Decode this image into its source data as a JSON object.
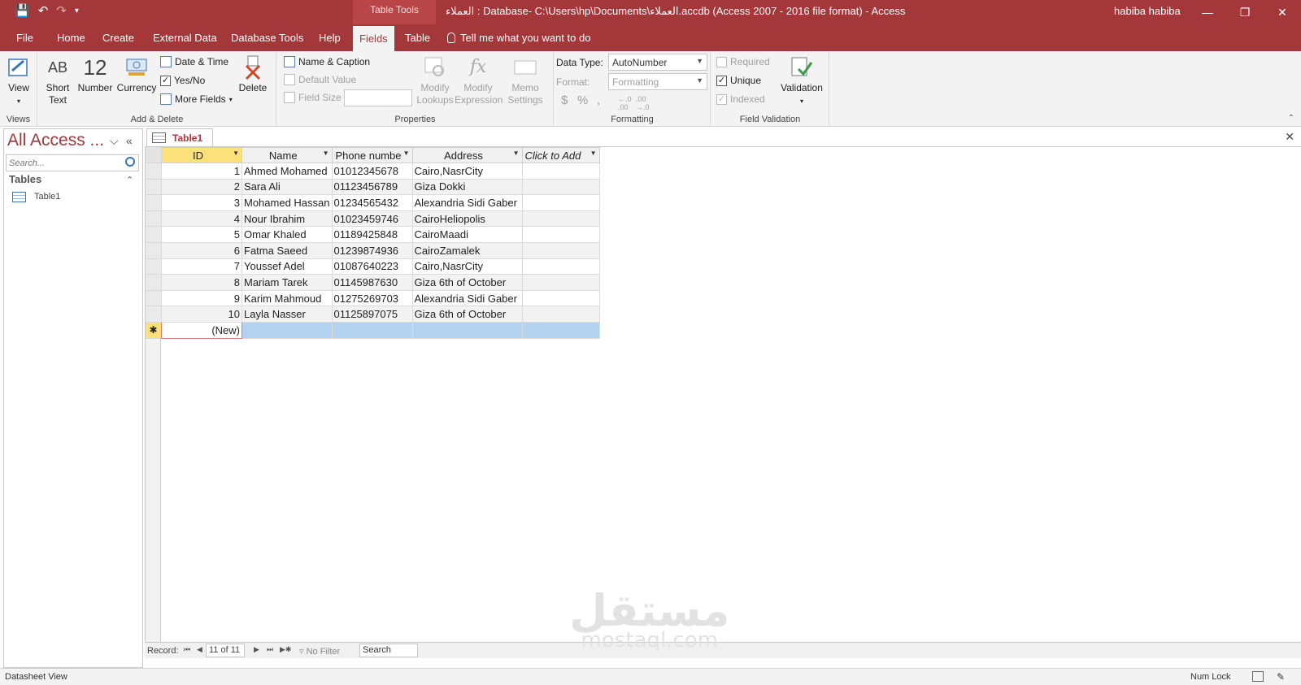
{
  "titlebar": {
    "context_tab": "Table Tools",
    "title": "العملاء : Database- C:\\Users\\hp\\Documents\\العملاء.accdb (Access 2007 - 2016 file format)  -  Access",
    "user": "habiba habiba"
  },
  "tabs": [
    "File",
    "Home",
    "Create",
    "External Data",
    "Database Tools",
    "Help",
    "Fields",
    "Table"
  ],
  "active_tab": "Fields",
  "tellme": "Tell me what you want to do",
  "ribbon": {
    "views": {
      "view_label": "View",
      "group_label": "Views"
    },
    "add_delete": {
      "short_text_glyph": "AB",
      "short_text": "Short Text",
      "number_glyph": "12",
      "number": "Number",
      "currency": "Currency",
      "date_time": "Date & Time",
      "yes_no": "Yes/No",
      "more_fields": "More Fields",
      "delete": "Delete",
      "group_label": "Add & Delete"
    },
    "properties": {
      "name_caption": "Name & Caption",
      "default_value": "Default Value",
      "field_size": "Field Size",
      "modify_lookups": "Modify Lookups",
      "modify_expression": "Modify Expression",
      "memo_settings": "Memo Settings",
      "group_label": "Properties"
    },
    "formatting": {
      "data_type_label": "Data Type:",
      "data_type_value": "AutoNumber",
      "format_label": "Format:",
      "format_value": "Formatting",
      "group_label": "Formatting"
    },
    "field_validation": {
      "required": "Required",
      "unique": "Unique",
      "indexed": "Indexed",
      "validation": "Validation",
      "group_label": "Field Validation"
    }
  },
  "nav": {
    "title": "All Access ...",
    "search_placeholder": "Search...",
    "group": "Tables",
    "items": [
      "Table1"
    ]
  },
  "document": {
    "tab": "Table1",
    "columns": [
      "ID",
      "Name",
      "Phone numbe",
      "Address",
      "Click to Add"
    ],
    "rows": [
      [
        "1",
        "Ahmed Mohamed",
        "01012345678",
        "Cairo,NasrCity"
      ],
      [
        "2",
        "Sara Ali",
        "01123456789",
        "Giza Dokki"
      ],
      [
        "3",
        "Mohamed Hassan",
        "01234565432",
        "Alexandria Sidi Gaber"
      ],
      [
        "4",
        "Nour Ibrahim",
        "01023459746",
        "CairoHeliopolis"
      ],
      [
        "5",
        "Omar Khaled",
        "01189425848",
        "CairoMaadi"
      ],
      [
        "6",
        "Fatma Saeed",
        "01239874936",
        "CairoZamalek"
      ],
      [
        "7",
        "Youssef Adel",
        "01087640223",
        "Cairo,NasrCity"
      ],
      [
        "8",
        "Mariam Tarek",
        "01145987630",
        "Giza 6th of October"
      ],
      [
        "9",
        "Karim Mahmoud",
        "01275269703",
        "Alexandria Sidi Gaber"
      ],
      [
        "10",
        "Layla Nasser",
        "01125897075",
        "Giza 6th of October"
      ]
    ],
    "new_row": "(New)"
  },
  "record_nav": {
    "label": "Record:",
    "position": "11 of 11",
    "filter": "No Filter",
    "search": "Search"
  },
  "status": {
    "left": "Datasheet View",
    "num_lock": "Num Lock"
  },
  "watermark": {
    "arabic": "مستقل",
    "latin": "mostaql.com"
  }
}
